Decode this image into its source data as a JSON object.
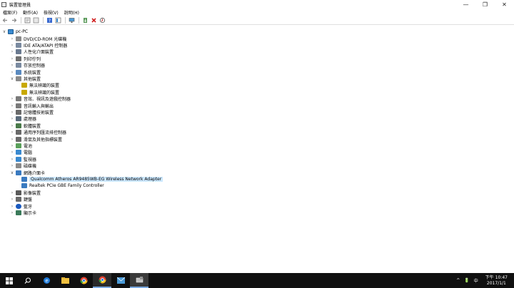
{
  "window": {
    "title": "裝置管理員",
    "minimize": "—",
    "restore": "❐",
    "close": "✕"
  },
  "menu": [
    "檔案(F)",
    "動作(A)",
    "檢視(V)",
    "說明(H)"
  ],
  "toolbar": [
    "back-icon",
    "forward-icon",
    "properties-icon",
    "refresh-icon",
    "help-icon",
    "view-icon",
    "monitor-icon",
    "update-driver-icon",
    "uninstall-icon",
    "scan-icon"
  ],
  "tree": {
    "root": "pc-PC",
    "items": [
      {
        "label": "DVD/CD-ROM 光碟機",
        "icon": "dvd-icon",
        "color": "#8a8a8a"
      },
      {
        "label": "IDE ATA/ATAPI 控制器",
        "icon": "ide-controller-icon",
        "color": "#7a8aa0"
      },
      {
        "label": "人性化介面裝置",
        "icon": "hid-icon",
        "color": "#6a7a90"
      },
      {
        "label": "列印佇列",
        "icon": "printer-icon",
        "color": "#707070"
      },
      {
        "label": "存放控制器",
        "icon": "storage-controller-icon",
        "color": "#7a8aa0"
      },
      {
        "label": "系統裝置",
        "icon": "system-device-icon",
        "color": "#5a8ac0"
      },
      {
        "label": "其他裝置",
        "icon": "other-device-icon",
        "color": "#8a8a8a",
        "expanded": true,
        "children": [
          {
            "label": "無法辨識的裝置",
            "icon": "warning-device-icon",
            "color": "#c8a800"
          },
          {
            "label": "無法辨識的裝置",
            "icon": "warning-device-icon",
            "color": "#c8a800"
          }
        ]
      },
      {
        "label": "音效、視訊及遊戲控制器",
        "icon": "audio-icon",
        "color": "#7a7a7a"
      },
      {
        "label": "音訊輸入與輸出",
        "icon": "audio-io-icon",
        "color": "#7a7a7a"
      },
      {
        "label": "記憶體技術裝置",
        "icon": "memory-icon",
        "color": "#6a6a6a"
      },
      {
        "label": "處理器",
        "icon": "processor-icon",
        "color": "#5a6a7a"
      },
      {
        "label": "軟體裝置",
        "icon": "software-device-icon",
        "color": "#4a7a4a"
      },
      {
        "label": "通用序列匯流排控制器",
        "icon": "usb-icon",
        "color": "#6a6a6a"
      },
      {
        "label": "滑鼠及其他指標裝置",
        "icon": "mouse-icon",
        "color": "#6a6a6a"
      },
      {
        "label": "電池",
        "icon": "battery-icon",
        "color": "#5aa05a"
      },
      {
        "label": "電腦",
        "icon": "computer-icon",
        "color": "#3a8ad0"
      },
      {
        "label": "監視器",
        "icon": "monitor-icon",
        "color": "#3a8ad0"
      },
      {
        "label": "磁碟機",
        "icon": "disk-icon",
        "color": "#8a8a8a"
      },
      {
        "label": "網路介面卡",
        "icon": "network-icon",
        "color": "#3a7ac0",
        "expanded": true,
        "children": [
          {
            "label": "Qualcomm Atheros AR9485WB-EG Wireless Network Adapter",
            "icon": "network-adapter-icon",
            "color": "#3a7ac0",
            "selected": true
          },
          {
            "label": "Realtek PCIe GBE Family Controller",
            "icon": "network-adapter-icon",
            "color": "#3a7ac0"
          }
        ]
      },
      {
        "label": "影像裝置",
        "icon": "camera-icon",
        "color": "#5a5a5a"
      },
      {
        "label": "鍵盤",
        "icon": "keyboard-icon",
        "color": "#6a6a6a"
      },
      {
        "label": "藍牙",
        "icon": "bluetooth-icon",
        "color": "#1a5ac0"
      },
      {
        "label": "顯示卡",
        "icon": "display-adapter-icon",
        "color": "#3a7a5a"
      }
    ]
  },
  "taskbar": {
    "apps": [
      "windows-start-icon",
      "search-icon",
      "edge-icon",
      "file-explorer-icon",
      "chrome-icon",
      "chrome-icon",
      "mail-icon",
      "device-manager-icon"
    ],
    "tray": [
      "^",
      "🔋",
      "中"
    ],
    "time": "下午 10:47",
    "date": "2017/1/1"
  }
}
